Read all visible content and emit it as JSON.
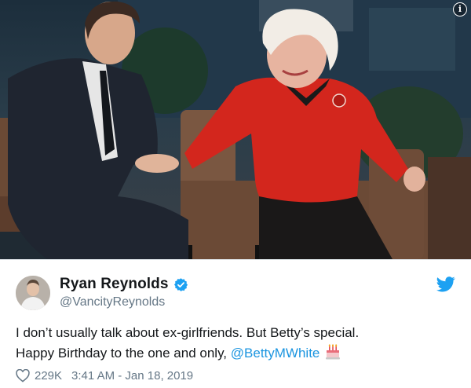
{
  "tweet": {
    "display_name": "Ryan Reynolds",
    "handle": "@VancityReynolds",
    "text_line1": "I don’t usually talk about ex-girlfriends. But Betty’s special.",
    "text_line2_prefix": "Happy Birthday to the one and only, ",
    "mention": "@BettyMWhite",
    "like_count": "229K",
    "timestamp": "3:41 AM - Jan 18, 2019"
  },
  "icons": {
    "verified": "verified-badge-icon",
    "brand": "twitter-bird-icon",
    "like": "heart-icon",
    "emoji": "birthday-cake-emoji",
    "info": "info-icon"
  },
  "colors": {
    "accent": "#1da1f2",
    "mention": "#1b95e0",
    "secondary_text": "#657786",
    "primary_text": "#14171a"
  },
  "photo": {
    "info_glyph": "i"
  }
}
